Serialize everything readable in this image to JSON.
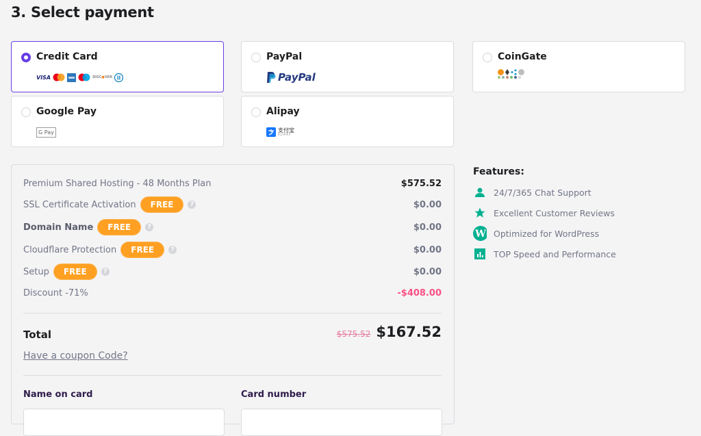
{
  "page": {
    "title": "3. Select payment"
  },
  "payment_methods": [
    {
      "label": "Credit Card",
      "selected": true,
      "logos": [
        "VISA",
        "Mastercard",
        "AmEx",
        "Maestro",
        "DISCOVER",
        "Diners"
      ]
    },
    {
      "label": "PayPal",
      "selected": false,
      "logo_text": "PayPal"
    },
    {
      "label": "CoinGate",
      "selected": false,
      "logos": [
        "Bitcoin",
        "Ethereum",
        "Ripple",
        "Litecoin"
      ]
    },
    {
      "label": "Google Pay",
      "selected": false,
      "logo_text": "G Pay"
    },
    {
      "label": "Alipay",
      "selected": false,
      "logo_text": "支付宝",
      "logo_sub": "ALIPAY"
    }
  ],
  "summary": {
    "items": [
      {
        "label": "Premium Shared Hosting - 48 Months Plan",
        "amount": "$575.52",
        "badge": null,
        "bold": false
      },
      {
        "label": "SSL Certificate Activation",
        "amount": "$0.00",
        "badge": "FREE",
        "bold": false
      },
      {
        "label": "Domain Name",
        "amount": "$0.00",
        "badge": "FREE",
        "bold": true
      },
      {
        "label": "Cloudflare Protection",
        "amount": "$0.00",
        "badge": "FREE",
        "bold": false
      },
      {
        "label": "Setup",
        "amount": "$0.00",
        "badge": "FREE",
        "bold": false
      },
      {
        "label": "Discount -71%",
        "amount": "-$408.00",
        "badge": null,
        "bold": false
      }
    ],
    "help_glyph": "?",
    "total_label": "Total",
    "old_price": "$575.52",
    "new_price": "$167.52",
    "coupon_link": "Have a coupon Code?",
    "fields": {
      "name_label": "Name on card",
      "name_value": "",
      "card_label": "Card number",
      "card_value": ""
    }
  },
  "features": {
    "title": "Features:",
    "items": [
      {
        "icon": "user-icon",
        "label": "24/7/365 Chat Support"
      },
      {
        "icon": "star-icon",
        "label": "Excellent Customer Reviews"
      },
      {
        "icon": "wordpress-icon",
        "label": "Optimized for WordPress"
      },
      {
        "icon": "chart-icon",
        "label": "TOP Speed and Performance"
      }
    ]
  },
  "colors": {
    "accent": "#673de6",
    "badge": "#ffa022",
    "discount": "#fc5185",
    "feature_icon": "#00b090"
  }
}
